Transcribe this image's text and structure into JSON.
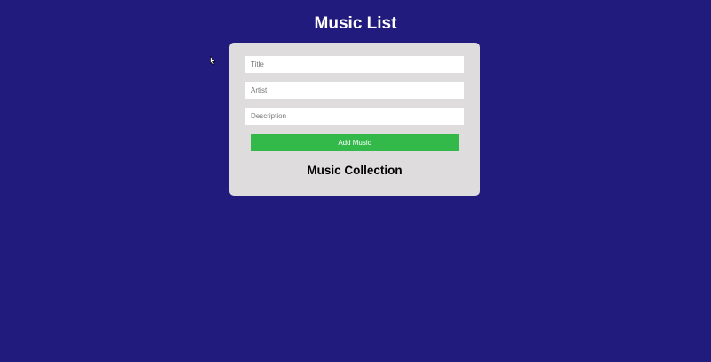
{
  "header": {
    "title": "Music List"
  },
  "form": {
    "title_placeholder": "Title",
    "artist_placeholder": "Artist",
    "description_placeholder": "Description",
    "title_value": "",
    "artist_value": "",
    "description_value": "",
    "add_button_label": "Add Music"
  },
  "collection": {
    "heading": "Music Collection",
    "items": []
  },
  "colors": {
    "background": "#201b7c",
    "card": "#dfdcdd",
    "accent": "#33b94a"
  }
}
